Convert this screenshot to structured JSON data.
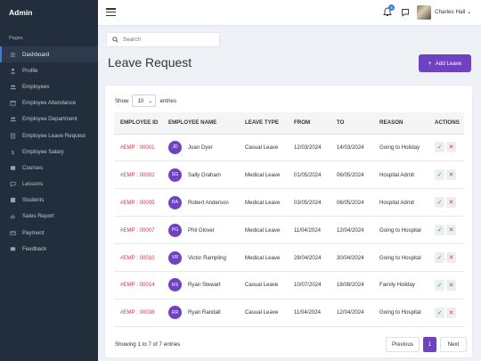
{
  "sidebar": {
    "brand": "Admin",
    "section": "Pages",
    "items": [
      {
        "label": "Dashboard",
        "icon": "sliders-icon"
      },
      {
        "label": "Profile",
        "icon": "user-icon"
      },
      {
        "label": "Employees",
        "icon": "users-icon"
      },
      {
        "label": "Employee Attendance",
        "icon": "calendar-icon"
      },
      {
        "label": "Employee Department",
        "icon": "users-icon"
      },
      {
        "label": "Employee Leave Request",
        "icon": "document-icon"
      },
      {
        "label": "Employee Salary",
        "icon": "dollar-icon"
      },
      {
        "label": "Courses",
        "icon": "list-icon"
      },
      {
        "label": "Lessons",
        "icon": "chat-icon"
      },
      {
        "label": "Students",
        "icon": "grid-icon"
      },
      {
        "label": "Sales Report",
        "icon": "bar-chart-icon"
      },
      {
        "label": "Payment",
        "icon": "card-icon"
      },
      {
        "label": "Feedback",
        "icon": "message-icon"
      }
    ]
  },
  "topbar": {
    "notification_count": "4",
    "user_name": "Charles Hall"
  },
  "search": {
    "placeholder": "Search"
  },
  "page": {
    "title": "Leave Request",
    "add_button": "Add Leave",
    "show_label": "Show",
    "entries_value": "10",
    "entries_label": "entries"
  },
  "table": {
    "headers": [
      "EMPLOYEE ID",
      "EMPLOYEE NAME",
      "LEAVE TYPE",
      "FROM",
      "TO",
      "REASON",
      "ACTIONS"
    ],
    "rows": [
      {
        "id": "#EMP : 00001",
        "initials": "JD",
        "name": "Joan Dyer",
        "type": "Casual Leave",
        "from": "12/03/2024",
        "to": "14/03/2024",
        "reason": "Going to Holiday"
      },
      {
        "id": "#EMP : 00002",
        "initials": "SG",
        "name": "Sally Graham",
        "type": "Medical Leave",
        "from": "01/05/2024",
        "to": "06/05/2024",
        "reason": "Hospital Admit"
      },
      {
        "id": "#EMP : 00005",
        "initials": "RA",
        "name": "Robert Anderson",
        "type": "Medical Leave",
        "from": "03/05/2024",
        "to": "06/05/2024",
        "reason": "Hospital Admit"
      },
      {
        "id": "#EMP : 00007",
        "initials": "PG",
        "name": "Phil Glover",
        "type": "Medical Leave",
        "from": "11/04/2024",
        "to": "12/04/2024",
        "reason": "Going to Hospital"
      },
      {
        "id": "#EMP : 00010",
        "initials": "VR",
        "name": "Victor Rampling",
        "type": "Medical Leave",
        "from": "28/04/2024",
        "to": "30/04/2024",
        "reason": "Going to Hospital"
      },
      {
        "id": "#EMP : 00014",
        "initials": "RS",
        "name": "Ryan Stewart",
        "type": "Casual Leave",
        "from": "10/07/2024",
        "to": "18/08/2024",
        "reason": "Family Holiday"
      },
      {
        "id": "#EMP : 00038",
        "initials": "RR",
        "name": "Ryan Randall",
        "type": "Casual Leave",
        "from": "11/04/2024",
        "to": "12/04/2024",
        "reason": "Going to Hospital"
      }
    ],
    "approve_symbol": "✓",
    "reject_symbol": "✕"
  },
  "footer": {
    "info": "Showing 1 to 7 of 7 entries",
    "prev": "Previous",
    "page": "1",
    "next": "Next"
  },
  "colors": {
    "accent": "#6f42c1",
    "sidebar": "#222e3c",
    "id_text": "#dc3545"
  }
}
